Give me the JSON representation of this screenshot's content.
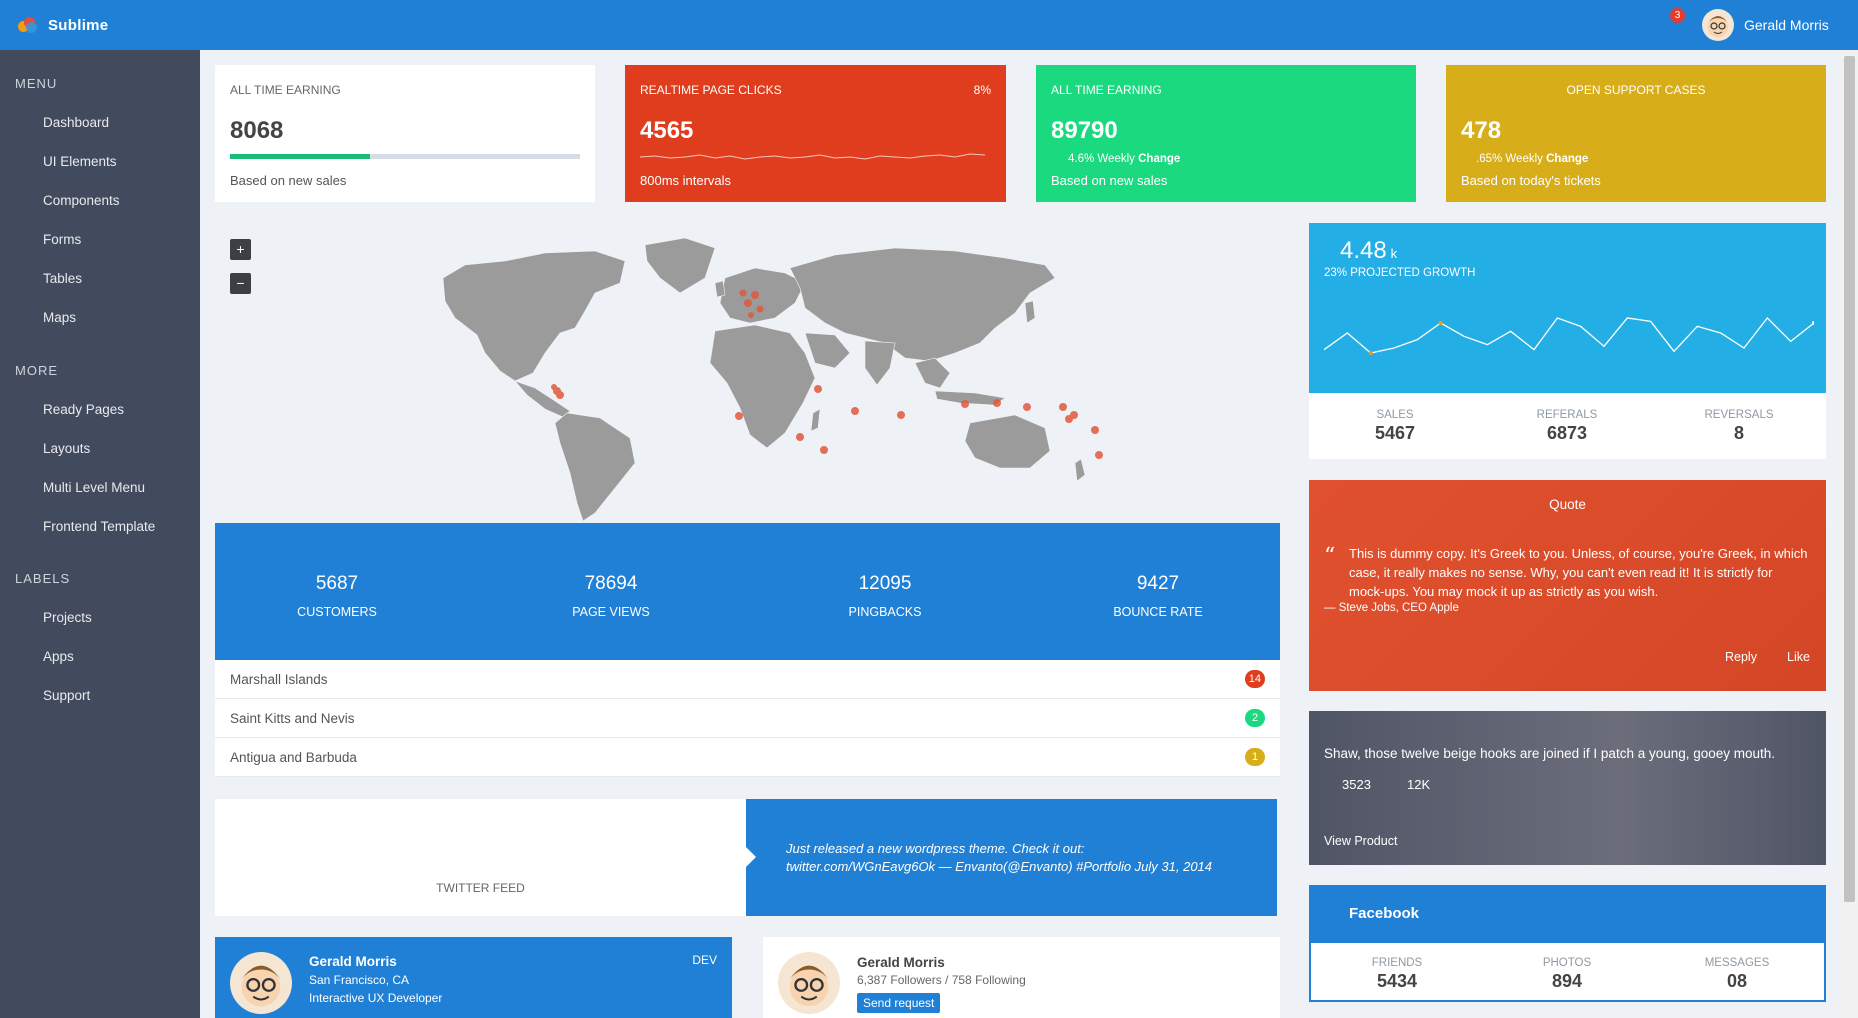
{
  "app": {
    "brand": "Sublime"
  },
  "topbar": {
    "notification_count": "3",
    "user_name": "Gerald Morris"
  },
  "sidebar": {
    "sections": [
      {
        "title": "MENU",
        "items": [
          "Dashboard",
          "UI Elements",
          "Components",
          "Forms",
          "Tables",
          "Maps"
        ]
      },
      {
        "title": "MORE",
        "items": [
          "Ready Pages",
          "Layouts",
          "Multi Level Menu",
          "Frontend Template"
        ]
      },
      {
        "title": "LABELS",
        "items": [
          "Projects",
          "Apps",
          "Support"
        ]
      }
    ]
  },
  "stat_cards": [
    {
      "label": "ALL TIME EARNING",
      "value": "8068",
      "sub": "Based on new sales",
      "progress_percent": 40,
      "bg": "#ffffff"
    },
    {
      "label": "REALTIME PAGE CLICKS",
      "badge": "8%",
      "value": "4565",
      "sub": "800ms intervals",
      "bg": "#df3d1e"
    },
    {
      "label": "ALL TIME EARNING",
      "value": "89790",
      "change_value": "4.6% Weekly",
      "change_word": "Change",
      "sub": "Based on new sales",
      "bg": "#1ad97f"
    },
    {
      "label": "OPEN SUPPORT CASES",
      "value": "478",
      "change_value": ".65% Weekly",
      "change_word": "Change",
      "sub": "Based on today's tickets",
      "bg": "#d8ad1a"
    }
  ],
  "map": {
    "zoom_in": "+",
    "zoom_out": "−"
  },
  "stats_strip": [
    {
      "value": "5687",
      "label": "CUSTOMERS"
    },
    {
      "value": "78694",
      "label": "PAGE VIEWS"
    },
    {
      "value": "12095",
      "label": "PINGBACKS"
    },
    {
      "value": "9427",
      "label": "BOUNCE RATE"
    }
  ],
  "countries": [
    {
      "name": "Marshall Islands",
      "count": "14",
      "color": "#df3d1e"
    },
    {
      "name": "Saint Kitts and Nevis",
      "count": "2",
      "color": "#1ad97f"
    },
    {
      "name": "Antigua and Barbuda",
      "count": "1",
      "color": "#d8ad1a"
    }
  ],
  "twitter": {
    "label": "TWITTER FEED",
    "tweet_line1": "Just released a new wordpress theme. Check it out:",
    "tweet_line2": "twitter.com/WGnEavg6Ok — Envanto(@Envanto) #Portfolio July 31, 2014"
  },
  "profile_card": {
    "name": "Gerald Morris",
    "location": "San Francisco, CA",
    "role": "Interactive UX Developer",
    "tag": "DEV"
  },
  "profile_follow": {
    "name": "Gerald Morris",
    "stats": "6,387 Followers / 758 Following",
    "button": "Send request"
  },
  "growth": {
    "value": "4.48",
    "unit": "k",
    "label": "23% PROJECTED GROWTH",
    "sparkline": [
      8,
      18,
      6,
      9,
      14,
      24,
      16,
      11,
      19,
      8,
      27,
      22,
      10,
      27,
      25,
      7,
      22,
      18,
      9,
      27,
      13,
      24
    ]
  },
  "growth_stats": [
    {
      "label": "SALES",
      "value": "5467"
    },
    {
      "label": "REFERALS",
      "value": "6873"
    },
    {
      "label": "REVERSALS",
      "value": "8"
    }
  ],
  "quote": {
    "title": "Quote",
    "text": "This is dummy copy. It's Greek to you. Unless, of course, you're Greek, in which case, it really makes no sense. Why, you can't even read it! It is strictly for mock-ups. You may mock it up as strictly as you wish.",
    "author": "— Steve Jobs, CEO Apple",
    "reply": "Reply",
    "like": "Like"
  },
  "product": {
    "text": "Shaw, those twelve beige hooks are joined if I patch a young, gooey mouth.",
    "stat1": "3523",
    "stat2": "12K",
    "link": "View Product"
  },
  "facebook": {
    "title": "Facebook",
    "stats": [
      {
        "label": "FRIENDS",
        "value": "5434"
      },
      {
        "label": "PHOTOS",
        "value": "894"
      },
      {
        "label": "MESSAGES",
        "value": "08"
      }
    ]
  }
}
